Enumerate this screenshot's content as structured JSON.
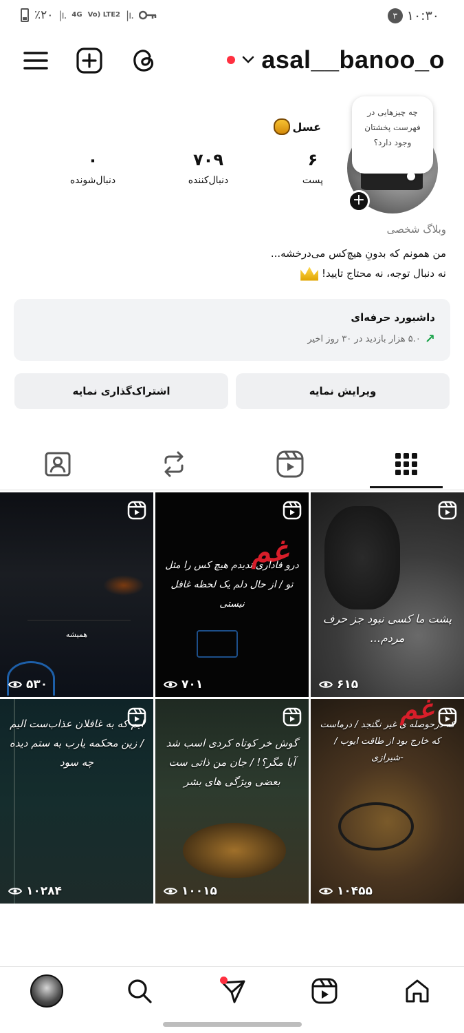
{
  "status_bar": {
    "battery": "٪۲۰",
    "network_1": "4G",
    "network_2": "Vo) LTE2",
    "notification_count": "۳",
    "time": "۱۰:۳۰"
  },
  "header": {
    "username": "asal__banoo_o"
  },
  "profile": {
    "note_text": "چه چیزهایی در فهرست پخشتان وجود دارد؟",
    "display_name": "عسل",
    "stats": [
      {
        "value": "۶",
        "label": "پست"
      },
      {
        "value": "۷۰۹",
        "label": "دنبال‌کننده"
      },
      {
        "value": "۰",
        "label": "دنبال‌شونده"
      }
    ],
    "category": "وبلاگ شخصی",
    "bio_line_1": "من همونم که بدونِ هیچ‌کس می‌درخشه...",
    "bio_line_2": "نه دنبال توجه، نه محتاج تایید!"
  },
  "dashboard": {
    "title": "داشبورد حرفه‌ای",
    "subtitle": "۵.۰ هزار بازدید در ۳۰ روز اخیر"
  },
  "buttons": {
    "edit_profile": "ویرایش نمایه",
    "share_profile": "اشتراک‌گذاری نمایه"
  },
  "grid": {
    "tiles": [
      {
        "views": "۵۳۰",
        "caption": "همیشه",
        "accent": ""
      },
      {
        "views": "۷۰۱",
        "caption": "درو فاداری ندیدم هیچ کس را مثل تو / از حال دلم یک لحظه غافل نیستی",
        "accent": "غم"
      },
      {
        "views": "۶۱۵",
        "caption": "پشت ما کسی نبود جز حرف مردم...",
        "accent": ""
      },
      {
        "views": "۱۰۲۸۴",
        "caption": "ایم که به غافلان عذاب‌ست الیم / زین محکمه یارب به ستم دیده چه سود",
        "accent": ""
      },
      {
        "views": "۱۰۰۱۵",
        "caption": "گوش خر کوتاه کردی اسب شد آیا مگر؟! / جان من ذاتی ست بعضی ویژگی های بشر",
        "accent": ""
      },
      {
        "views": "۱۰۴۵۵",
        "caption": "که درحوصله ی غیر نگنجد / درماست که خارج بود از طاقت ایوب / -شیرازی",
        "accent": "غم"
      }
    ]
  },
  "colors": {
    "accent_red": "#ff3040",
    "trend_green": "#1aa34a",
    "button_bg": "#eff0f2"
  }
}
